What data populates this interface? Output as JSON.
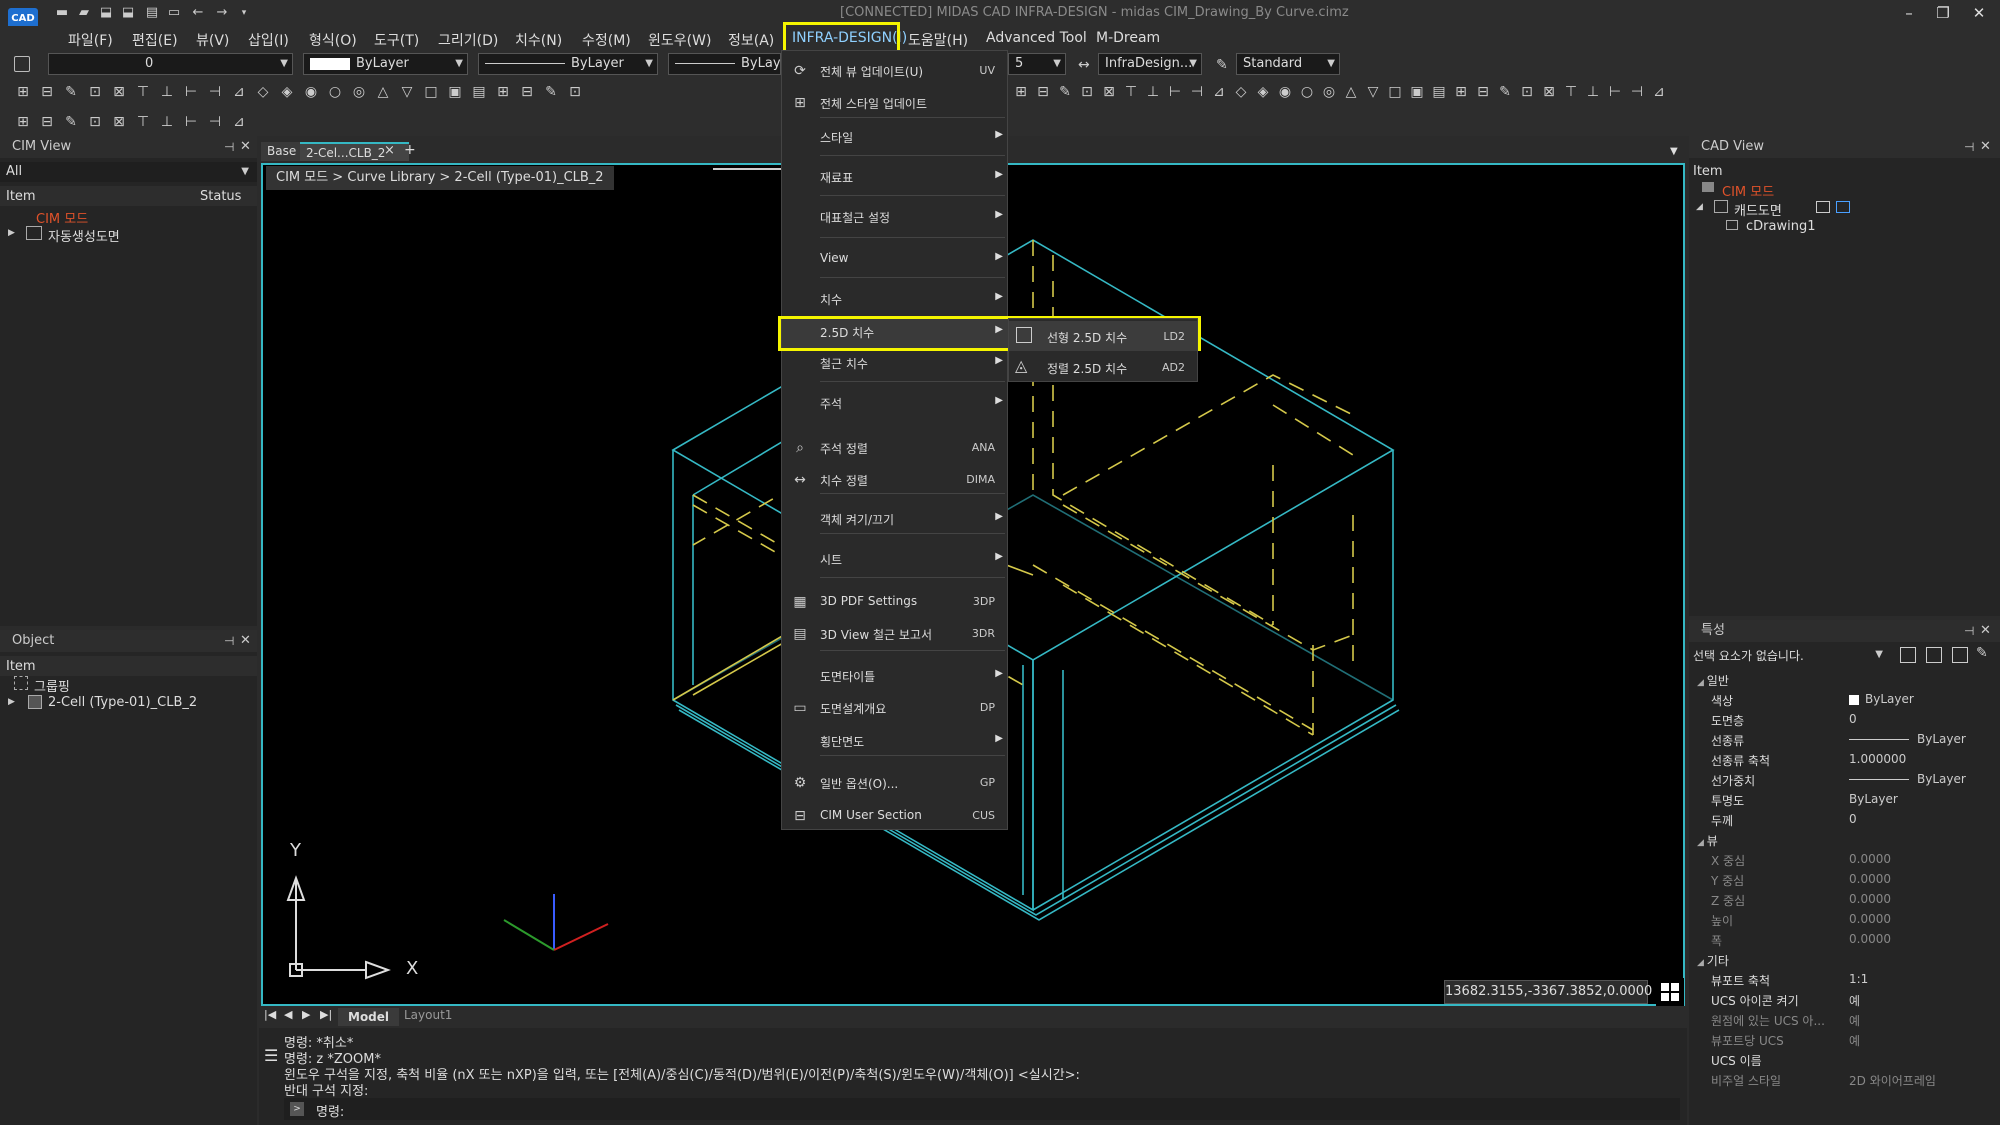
{
  "window": {
    "title": "[CONNECTED] MIDAS CAD INFRA-DESIGN - midas CIM_Drawing_By Curve.cimz",
    "logo_text": "CAD"
  },
  "menubar": {
    "items": [
      "파일(F)",
      "편집(E)",
      "뷰(V)",
      "삽입(I)",
      "형식(O)",
      "도구(T)",
      "그리기(D)",
      "치수(N)",
      "수정(M)",
      "윈도우(W)",
      "정보(A)",
      "INFRA-DESIGN(I)",
      "도움말(H)",
      "Advanced Tool",
      "M-Dream"
    ],
    "active": "INFRA-DESIGN(I)"
  },
  "toolbar": {
    "layer_value": "0",
    "color_value": "ByLayer",
    "linetype_value": "ByLayer",
    "lineweight_value": "ByLay",
    "dimstyle_value": "InfraDesign...",
    "textstyle_value": "Standard",
    "scale_value": "5"
  },
  "cim_view": {
    "title": "CIM View",
    "filter": "All",
    "col_item": "Item",
    "col_status": "Status",
    "root": "CIM 모드",
    "children": [
      "자동생성도면"
    ]
  },
  "object_panel": {
    "title": "Object",
    "col_item": "Item",
    "items": [
      "그룹핑",
      "2-Cell (Type-01)_CLB_2"
    ]
  },
  "tabs": {
    "items": [
      "Base",
      "2-Cel...CLB_2"
    ],
    "close": "×",
    "add": "+"
  },
  "breadcrumb": "CIM 모드 > Curve Library > 2-Cell (Type-01)_CLB_2",
  "context_menu": {
    "items": [
      {
        "label": "전체 뷰 업데이트(U)",
        "shortcut": "UV",
        "submenu": false,
        "icon": "view-update-icon"
      },
      {
        "label": "전체 스타일 업데이트",
        "shortcut": "",
        "submenu": false,
        "icon": "style-update-icon"
      },
      {
        "label": "스타일",
        "shortcut": "",
        "submenu": true,
        "icon": ""
      },
      {
        "label": "재료표",
        "shortcut": "",
        "submenu": true,
        "icon": ""
      },
      {
        "label": "대표철근 설정",
        "shortcut": "",
        "submenu": true,
        "icon": ""
      },
      {
        "label": "View",
        "shortcut": "",
        "submenu": true,
        "icon": ""
      },
      {
        "label": "치수",
        "shortcut": "",
        "submenu": true,
        "icon": ""
      },
      {
        "label": "2.5D 치수",
        "shortcut": "",
        "submenu": true,
        "icon": ""
      },
      {
        "label": "철근 치수",
        "shortcut": "",
        "submenu": true,
        "icon": ""
      },
      {
        "label": "주석",
        "shortcut": "",
        "submenu": true,
        "icon": ""
      },
      {
        "label": "주석 정렬",
        "shortcut": "ANA",
        "submenu": false,
        "icon": "annotation-align-icon"
      },
      {
        "label": "치수 정렬",
        "shortcut": "DIMA",
        "submenu": false,
        "icon": "dim-align-icon"
      },
      {
        "label": "객체 켜기/끄기",
        "shortcut": "",
        "submenu": true,
        "icon": ""
      },
      {
        "label": "시트",
        "shortcut": "",
        "submenu": true,
        "icon": ""
      },
      {
        "label": "3D PDF Settings",
        "shortcut": "3DP",
        "submenu": false,
        "icon": "pdf-icon"
      },
      {
        "label": "3D View 철근 보고서",
        "shortcut": "3DR",
        "submenu": false,
        "icon": "report-icon"
      },
      {
        "label": "도면타이틀",
        "shortcut": "",
        "submenu": true,
        "icon": ""
      },
      {
        "label": "도면설계개요",
        "shortcut": "DP",
        "submenu": false,
        "icon": "design-overview-icon"
      },
      {
        "label": "횡단면도",
        "shortcut": "",
        "submenu": true,
        "icon": ""
      },
      {
        "label": "일반 옵션(O)...",
        "shortcut": "GP",
        "submenu": false,
        "icon": "gear-icon"
      },
      {
        "label": "CIM User Section",
        "shortcut": "CUS",
        "submenu": false,
        "icon": "section-icon"
      }
    ],
    "highlighted": "2.5D 치수"
  },
  "submenu": {
    "items": [
      {
        "label": "선형 2.5D 치수",
        "shortcut": "LD2"
      },
      {
        "label": "정렬 2.5D 치수",
        "shortcut": "AD2"
      }
    ]
  },
  "cad_view": {
    "title": "CAD View",
    "col_item": "Item",
    "root": "CIM 모드",
    "child": "캐드도면",
    "grandchild": "cDrawing1"
  },
  "properties": {
    "title": "특성",
    "selection": "선택 요소가 없습니다.",
    "sections": [
      {
        "name": "일반",
        "rows": [
          {
            "k": "색상",
            "v": "ByLayer"
          },
          {
            "k": "도면층",
            "v": "0"
          },
          {
            "k": "선종류",
            "v": "ByLayer"
          },
          {
            "k": "선종류 축척",
            "v": "1.000000"
          },
          {
            "k": "선가중치",
            "v": "ByLayer"
          },
          {
            "k": "투명도",
            "v": "ByLayer"
          },
          {
            "k": "두께",
            "v": "0"
          }
        ]
      },
      {
        "name": "뷰",
        "rows": [
          {
            "k": "X 중심",
            "v": "0.0000"
          },
          {
            "k": "Y 중심",
            "v": "0.0000"
          },
          {
            "k": "Z 중심",
            "v": "0.0000"
          },
          {
            "k": "높이",
            "v": "0.0000"
          },
          {
            "k": "폭",
            "v": "0.0000"
          }
        ]
      },
      {
        "name": "기타",
        "rows": [
          {
            "k": "뷰포트 축척",
            "v": "1:1"
          },
          {
            "k": "UCS 아이콘 켜기",
            "v": "예"
          },
          {
            "k": "원점에 있는 UCS 아...",
            "v": "예"
          },
          {
            "k": "뷰포트당 UCS",
            "v": "예"
          },
          {
            "k": "UCS 이름",
            "v": ""
          },
          {
            "k": "비주얼 스타일",
            "v": "2D 와이어프레임"
          }
        ]
      }
    ]
  },
  "viewport": {
    "coords": "13682.3155,-3367.3852,0.0000",
    "axis_x": "X",
    "axis_y": "Y"
  },
  "layout_tabs": [
    "Model",
    "Layout1"
  ],
  "command": {
    "lines": [
      "명령:  *취소*",
      "명령:  z *ZOOM*",
      "윈도우 구석을 지정, 축척 비율 (nX 또는 nXP)을 입력, 또는 [전체(A)/중심(C)/동적(D)/범위(E)/이전(P)/축척(S)/윈도우(W)/객체(O)] <실시간>:",
      "반대 구석 지정:"
    ],
    "prompt": "명령:"
  },
  "colors": {
    "accent": "#35b8c4",
    "highlight": "#f5f500",
    "cim_mode": "#e0522a",
    "dashed": "#d4c84a"
  }
}
